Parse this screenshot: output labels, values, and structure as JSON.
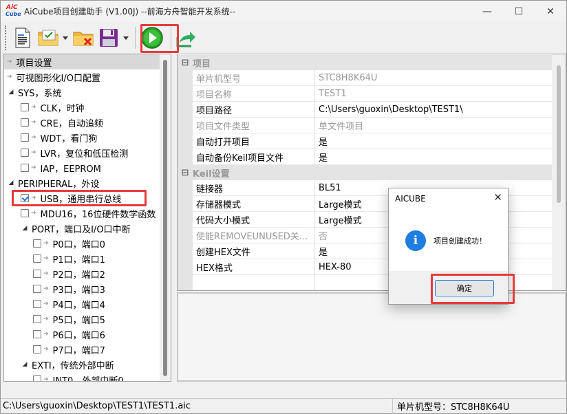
{
  "window": {
    "logo_top": "AiC",
    "logo_bottom": "Cube",
    "title": "AiCube项目创建助手 (V1.00J) --前海方舟智能开发系统--",
    "minimize": "—",
    "maximize": "☐",
    "close": "✕"
  },
  "toolbar": {
    "buttons": [
      {
        "name": "new-project",
        "icon": "document-icon"
      },
      {
        "name": "open-project",
        "icon": "folder-check-icon"
      },
      {
        "name": "close-project",
        "icon": "folder-delete-icon"
      },
      {
        "name": "save-project",
        "icon": "floppy-icon"
      },
      {
        "name": "run-build",
        "icon": "green-play-icon"
      },
      {
        "name": "export",
        "icon": "export-arrow-icon"
      }
    ]
  },
  "tree": {
    "items": [
      {
        "label": "项目设置",
        "level": 0,
        "kind": "arrow",
        "selected": true
      },
      {
        "label": "可视图形化I/O口配置",
        "level": 0,
        "kind": "arrow"
      },
      {
        "label": "SYS，系统",
        "level": 0,
        "kind": "expander"
      },
      {
        "label": "CLK，时钟",
        "level": 1,
        "kind": "check",
        "checked": false
      },
      {
        "label": "CRE，自动追频",
        "level": 1,
        "kind": "check",
        "checked": false
      },
      {
        "label": "WDT，看门狗",
        "level": 1,
        "kind": "check",
        "checked": false
      },
      {
        "label": "LVR，复位和低压检测",
        "level": 1,
        "kind": "check",
        "checked": false
      },
      {
        "label": "IAP，EEPROM",
        "level": 1,
        "kind": "check",
        "checked": false
      },
      {
        "label": "PERIPHERAL，外设",
        "level": 0,
        "kind": "expander"
      },
      {
        "label": "USB，通用串行总线",
        "level": 1,
        "kind": "check",
        "checked": true
      },
      {
        "label": "MDU16，16位硬件数学函数",
        "level": 1,
        "kind": "check",
        "checked": false
      },
      {
        "label": "PORT，端口及I/O口中断",
        "level": 1,
        "kind": "expander"
      },
      {
        "label": "P0口，端口0",
        "level": 2,
        "kind": "check",
        "checked": false
      },
      {
        "label": "P1口，端口1",
        "level": 2,
        "kind": "check",
        "checked": false
      },
      {
        "label": "P2口，端口2",
        "level": 2,
        "kind": "check",
        "checked": false
      },
      {
        "label": "P3口，端口3",
        "level": 2,
        "kind": "check",
        "checked": false
      },
      {
        "label": "P4口，端口4",
        "level": 2,
        "kind": "check",
        "checked": false
      },
      {
        "label": "P5口，端口5",
        "level": 2,
        "kind": "check",
        "checked": false
      },
      {
        "label": "P6口，端口6",
        "level": 2,
        "kind": "check",
        "checked": false
      },
      {
        "label": "P7口，端口7",
        "level": 2,
        "kind": "check",
        "checked": false
      },
      {
        "label": "EXTI，传统外部中断",
        "level": 1,
        "kind": "expander"
      },
      {
        "label": "INT0，外部中断0",
        "level": 2,
        "kind": "check",
        "checked": false
      }
    ]
  },
  "properties": {
    "groups": [
      {
        "title": "项目",
        "rows": [
          {
            "name": "单片机型号",
            "value": "STC8H8K64U",
            "disabled": true
          },
          {
            "name": "项目名称",
            "value": "TEST1",
            "disabled": true
          },
          {
            "name": "项目路径",
            "value": "C:\\Users\\guoxin\\Desktop\\TEST1\\",
            "disabled": false
          },
          {
            "name": "项目文件类型",
            "value": "单文件项目",
            "disabled": true
          },
          {
            "name": "自动打开项目",
            "value": "是",
            "disabled": false
          },
          {
            "name": "自动备份Keil项目文件",
            "value": "是",
            "disabled": false
          }
        ]
      },
      {
        "title": "Keil设置",
        "rows": [
          {
            "name": "链接器",
            "value": "BL51",
            "disabled": false
          },
          {
            "name": "存储器模式",
            "value": "Large模式",
            "disabled": false
          },
          {
            "name": "代码大小模式",
            "value": "Large模式",
            "disabled": false
          },
          {
            "name": "使能REMOVEUNUSED关...",
            "value": "否",
            "disabled": true
          },
          {
            "name": "创建HEX文件",
            "value": "是",
            "disabled": false
          },
          {
            "name": "HEX格式",
            "value": "HEX-80",
            "disabled": false
          }
        ]
      }
    ]
  },
  "status": {
    "path": "C:\\Users\\guoxin\\Desktop\\TEST1\\TEST1.aic",
    "mcu": "单片机型号：STC8H8K64U"
  },
  "dialog": {
    "title": "AICUBE",
    "close": "✕",
    "icon": "info-icon",
    "icon_glyph": "i",
    "message": "项目创建成功！",
    "ok_label": "确定"
  },
  "colors": {
    "highlight_box": "#e63a3a",
    "play_green": "#2aa02a",
    "info_blue": "#1e7de0"
  }
}
